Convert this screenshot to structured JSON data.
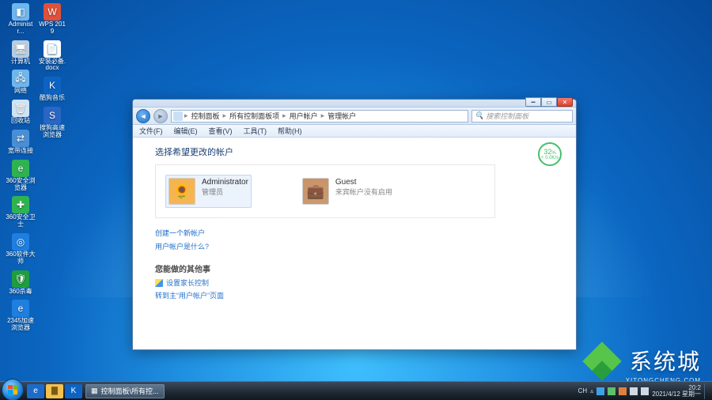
{
  "desktop_icons_col1": [
    {
      "label": "Administr...",
      "color": "#6fb6ef",
      "glyph": "◧"
    },
    {
      "label": "计算机",
      "color": "#b9cde2",
      "glyph": "🖥"
    },
    {
      "label": "网络",
      "color": "#6fb6ef",
      "glyph": "🖧"
    },
    {
      "label": "回收站",
      "color": "#cfe4f7",
      "glyph": "🗑"
    },
    {
      "label": "宽带连接",
      "color": "#4a8fd6",
      "glyph": "⇄"
    },
    {
      "label": "360安全浏览器",
      "color": "#2fb351",
      "glyph": "e"
    },
    {
      "label": "360安全卫士",
      "color": "#2fb351",
      "glyph": "✚"
    },
    {
      "label": "360软件大师",
      "color": "#1f7fe0",
      "glyph": "◎"
    },
    {
      "label": "360杀毒",
      "color": "#1e9e3e",
      "glyph": "🛡"
    },
    {
      "label": "2345加速浏览器",
      "color": "#1f7fe0",
      "glyph": "e"
    }
  ],
  "desktop_icons_col2": [
    {
      "label": "WPS 2019",
      "color": "#e0503a",
      "glyph": "W"
    },
    {
      "label": "安装必备.docx",
      "color": "#ffffff",
      "glyph": "📄"
    },
    {
      "label": "酷狗音乐",
      "color": "#0d63c4",
      "glyph": "K"
    },
    {
      "label": "搜狗高速浏览器",
      "color": "#2b66c4",
      "glyph": "S"
    }
  ],
  "window": {
    "breadcrumbs": [
      "控制面板",
      "所有控制面板项",
      "用户帐户",
      "管理帐户"
    ],
    "search_placeholder": "搜索控制面板",
    "menus": [
      "文件(F)",
      "编辑(E)",
      "查看(V)",
      "工具(T)",
      "帮助(H)"
    ],
    "heading": "选择希望更改的帐户",
    "accounts": [
      {
        "name": "Administrator",
        "sub": "管理员",
        "avatar_bg": "#f6b24a",
        "glyph": "🌻",
        "selected": true
      },
      {
        "name": "Guest",
        "sub": "来宾帐户没有启用",
        "avatar_bg": "#c48b5b",
        "glyph": "💼",
        "selected": false
      }
    ],
    "links": [
      "创建一个新帐户",
      "用户帐户是什么?"
    ],
    "extra_heading": "您能做的其他事",
    "extra_links": [
      "设置家长控制",
      "转到主“用户帐户”页面"
    ],
    "badge_pct": "32",
    "badge_sub": "+ 0.0K/s"
  },
  "taskbar": {
    "task_label": "控制面板\\所有控...",
    "tray_text": "CH",
    "time": "20:2",
    "date": "2021/4/12 星期一"
  },
  "watermark": {
    "text": "系统城",
    "sub": "XITONGCHENG.COM"
  }
}
